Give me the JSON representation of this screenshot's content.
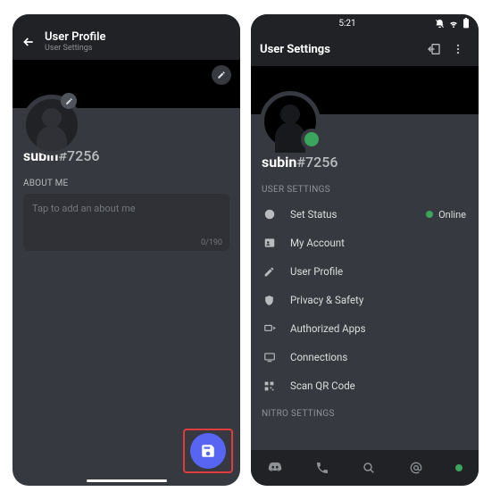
{
  "left": {
    "header": {
      "title": "User Profile",
      "subtitle": "User Settings"
    },
    "username": "subin",
    "discriminator": "#7256",
    "about": {
      "section_label": "ABOUT ME",
      "placeholder": "Tap to add an about me",
      "counter": "0/190"
    }
  },
  "right": {
    "status_time": "5:21",
    "header_title": "User Settings",
    "username": "subin",
    "discriminator": "#7256",
    "section_label": "USER SETTINGS",
    "status_value": "Online",
    "items": {
      "0": {
        "label": "Set Status"
      },
      "1": {
        "label": "My Account"
      },
      "2": {
        "label": "User Profile"
      },
      "3": {
        "label": "Privacy & Safety"
      },
      "4": {
        "label": "Authorized Apps"
      },
      "5": {
        "label": "Connections"
      },
      "6": {
        "label": "Scan QR Code"
      }
    },
    "nitro_label": "NITRO SETTINGS"
  }
}
